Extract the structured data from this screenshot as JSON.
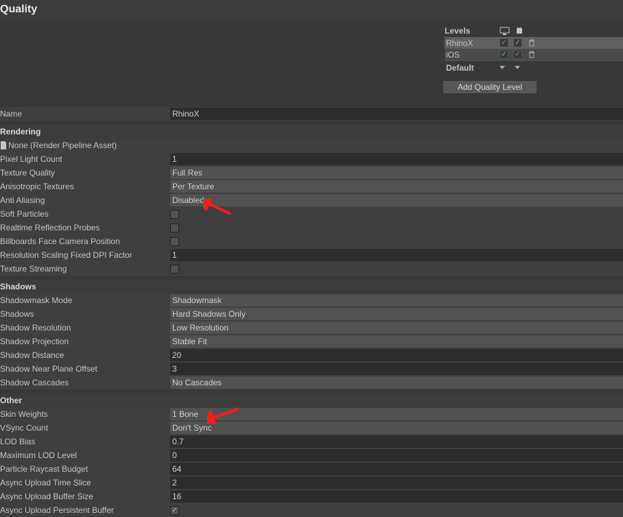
{
  "title": "Quality",
  "levels": {
    "header": "Levels",
    "rows": [
      {
        "name": "RhinoX",
        "desktop": "on",
        "mobile": "green"
      },
      {
        "name": "iOS",
        "desktop": "green",
        "mobile": "on"
      }
    ],
    "default": "Default",
    "add_button": "Add Quality Level"
  },
  "name": {
    "label": "Name",
    "value": "RhinoX"
  },
  "rendering": {
    "header": "Rendering",
    "pipeline": "None (Render Pipeline Asset)",
    "pixel_light_count": {
      "label": "Pixel Light Count",
      "value": "1"
    },
    "texture_quality": {
      "label": "Texture Quality",
      "value": "Full Res"
    },
    "anisotropic": {
      "label": "Anisotropic Textures",
      "value": "Per Texture"
    },
    "anti_aliasing": {
      "label": "Anti Aliasing",
      "value": "Disabled"
    },
    "soft_particles": {
      "label": "Soft Particles",
      "value": false
    },
    "realtime_reflection": {
      "label": "Realtime Reflection Probes",
      "value": false
    },
    "billboards": {
      "label": "Billboards Face Camera Position",
      "value": false
    },
    "resolution_scaling": {
      "label": "Resolution Scaling Fixed DPI Factor",
      "value": "1"
    },
    "texture_streaming": {
      "label": "Texture Streaming",
      "value": false
    }
  },
  "shadows": {
    "header": "Shadows",
    "shadowmask_mode": {
      "label": "Shadowmask Mode",
      "value": "Shadowmask"
    },
    "shadows_field": {
      "label": "Shadows",
      "value": "Hard Shadows Only"
    },
    "resolution": {
      "label": "Shadow Resolution",
      "value": "Low Resolution"
    },
    "projection": {
      "label": "Shadow Projection",
      "value": "Stable Fit"
    },
    "distance": {
      "label": "Shadow Distance",
      "value": "20"
    },
    "near_plane": {
      "label": "Shadow Near Plane Offset",
      "value": "3"
    },
    "cascades": {
      "label": "Shadow Cascades",
      "value": "No Cascades"
    }
  },
  "other": {
    "header": "Other",
    "skin_weights": {
      "label": "Skin Weights",
      "value": "1 Bone"
    },
    "vsync": {
      "label": "VSync Count",
      "value": "Don't Sync"
    },
    "lod_bias": {
      "label": "LOD Bias",
      "value": "0.7"
    },
    "max_lod": {
      "label": "Maximum LOD Level",
      "value": "0"
    },
    "particle_raycast": {
      "label": "Particle Raycast Budget",
      "value": "64"
    },
    "async_time": {
      "label": "Async Upload Time Slice",
      "value": "2"
    },
    "async_buffer": {
      "label": "Async Upload Buffer Size",
      "value": "16"
    },
    "async_persistent": {
      "label": "Async Upload Persistent Buffer",
      "value": true
    }
  }
}
